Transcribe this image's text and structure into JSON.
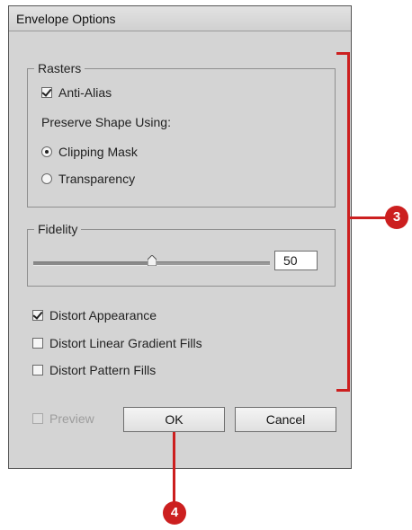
{
  "dialog": {
    "title": "Envelope Options"
  },
  "rasters": {
    "legend": "Rasters",
    "anti_alias": {
      "label": "Anti-Alias",
      "checked": true
    },
    "preserve_shape_label": "Preserve Shape Using:",
    "options": [
      {
        "label": "Clipping Mask",
        "selected": true
      },
      {
        "label": "Transparency",
        "selected": false
      }
    ]
  },
  "fidelity": {
    "legend": "Fidelity",
    "value": "50",
    "slider_percent": 50
  },
  "options": {
    "distort_appearance": {
      "label": "Distort Appearance",
      "checked": true
    },
    "distort_linear_gradient": {
      "label": "Distort Linear Gradient Fills",
      "checked": false
    },
    "distort_pattern": {
      "label": "Distort Pattern Fills",
      "checked": false
    }
  },
  "preview": {
    "label": "Preview",
    "checked": false,
    "enabled": false
  },
  "buttons": {
    "ok": "OK",
    "cancel": "Cancel"
  },
  "callouts": {
    "three": "3",
    "four": "4",
    "color": "#cc1f1f"
  }
}
